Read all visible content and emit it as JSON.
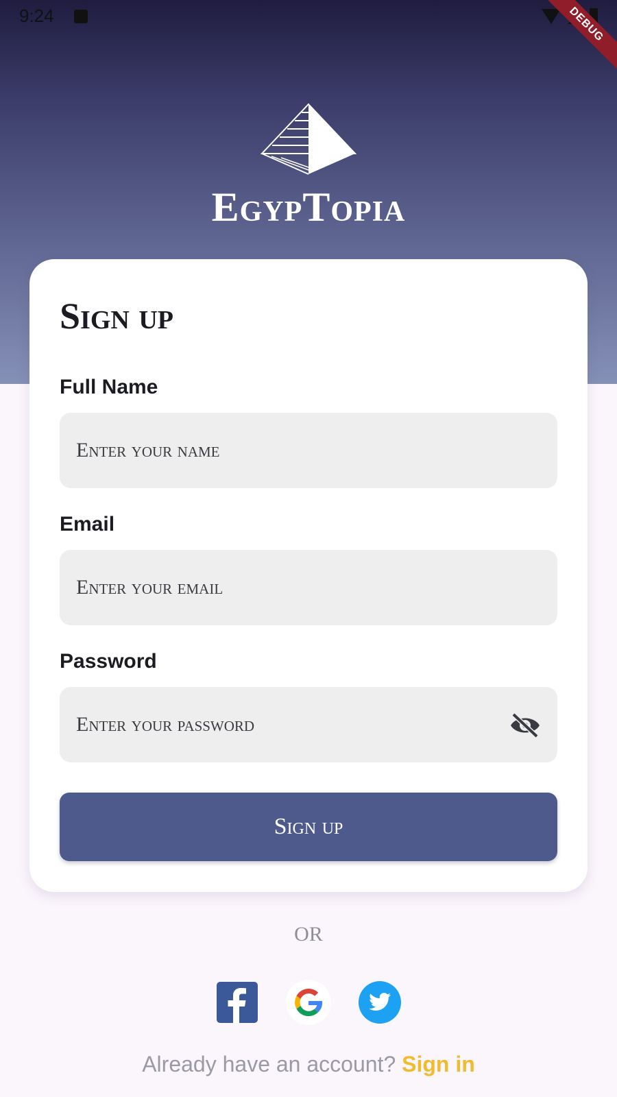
{
  "status_bar": {
    "time": "9:24"
  },
  "debug_banner": "DEBUG",
  "app": {
    "name": "EgypTopia"
  },
  "form": {
    "title": "Sign up",
    "fields": [
      {
        "label": "Full Name",
        "placeholder": "Enter your name",
        "value": ""
      },
      {
        "label": "Email",
        "placeholder": "Enter your email",
        "value": ""
      },
      {
        "label": "Password",
        "placeholder": "Enter your password",
        "value": ""
      }
    ],
    "submit_label": "Sign up"
  },
  "divider_text": "OR",
  "social": [
    {
      "name": "facebook-icon",
      "color": "#3b5998"
    },
    {
      "name": "google-icon",
      "colors": [
        "#4285F4",
        "#DB4437",
        "#F4B400",
        "#0F9D58"
      ]
    },
    {
      "name": "twitter-icon",
      "color": "#1da1f2"
    }
  ],
  "footer": {
    "prompt": "Already have an account?",
    "link": "Sign in"
  },
  "colors": {
    "primary_button": "#4f5a8c",
    "link_accent": "#f0bb2d",
    "hero_top": "#1f1c3f",
    "hero_bottom": "#8590b7"
  }
}
